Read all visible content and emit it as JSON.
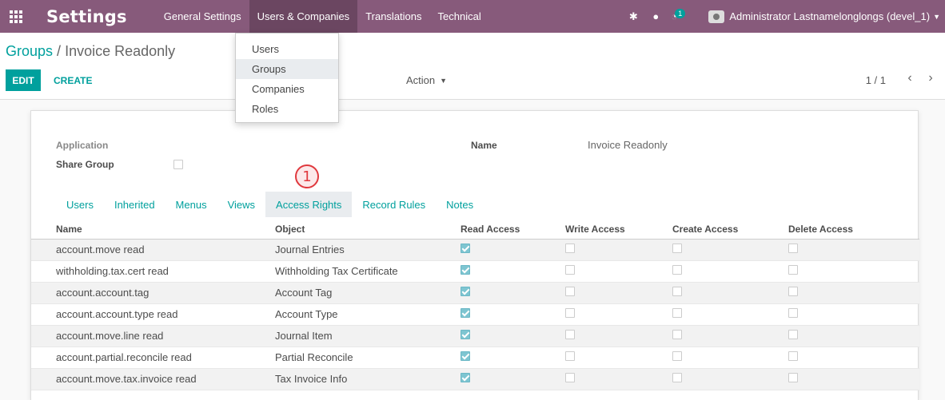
{
  "navbar": {
    "brand": "Settings",
    "menu": [
      "General Settings",
      "Users & Companies",
      "Translations",
      "Technical"
    ],
    "activity_count": "1",
    "user": "Administrator Lastnamelonglongs (devel_1)",
    "accent_color": "#875A7B"
  },
  "dropdown": {
    "items": [
      "Users",
      "Groups",
      "Companies",
      "Roles"
    ],
    "active": "Groups"
  },
  "breadcrumb": {
    "parent": "Groups",
    "separator": "/",
    "current": "Invoice Readonly"
  },
  "buttons": {
    "edit": "EDIT",
    "create": "CREATE",
    "action": "Action"
  },
  "pager": {
    "value": "1 / 1"
  },
  "form": {
    "application_label": "Application",
    "share_group_label": "Share Group",
    "share_group_checked": false,
    "name_label": "Name",
    "name_value": "Invoice Readonly"
  },
  "marker": "1",
  "tabs": [
    "Users",
    "Inherited",
    "Menus",
    "Views",
    "Access Rights",
    "Record Rules",
    "Notes"
  ],
  "active_tab": "Access Rights",
  "table": {
    "columns": [
      "Name",
      "Object",
      "Read Access",
      "Write Access",
      "Create Access",
      "Delete Access"
    ],
    "rows": [
      {
        "name": "account.move read",
        "object": "Journal Entries",
        "read": true,
        "write": false,
        "create": false,
        "delete": false
      },
      {
        "name": "withholding.tax.cert read",
        "object": "Withholding Tax Certificate",
        "read": true,
        "write": false,
        "create": false,
        "delete": false
      },
      {
        "name": "account.account.tag",
        "object": "Account Tag",
        "read": true,
        "write": false,
        "create": false,
        "delete": false
      },
      {
        "name": "account.account.type read",
        "object": "Account Type",
        "read": true,
        "write": false,
        "create": false,
        "delete": false
      },
      {
        "name": "account.move.line read",
        "object": "Journal Item",
        "read": true,
        "write": false,
        "create": false,
        "delete": false
      },
      {
        "name": "account.partial.reconcile read",
        "object": "Partial Reconcile",
        "read": true,
        "write": false,
        "create": false,
        "delete": false
      },
      {
        "name": "account.move.tax.invoice read",
        "object": "Tax Invoice Info",
        "read": true,
        "write": false,
        "create": false,
        "delete": false
      }
    ]
  }
}
